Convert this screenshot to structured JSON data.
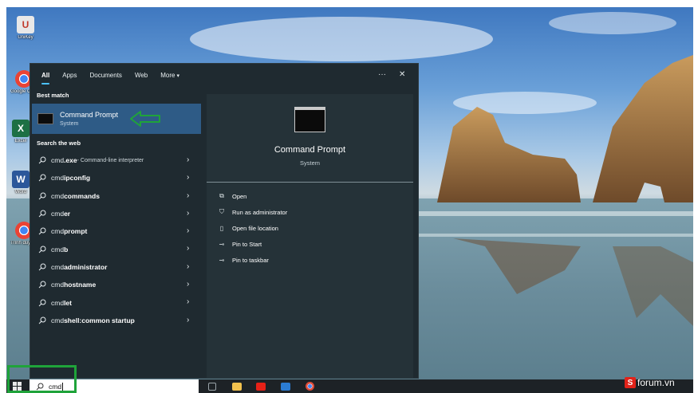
{
  "desktop_icons": [
    {
      "label": "UniKey",
      "icon": "unikey-icon",
      "color": "#d9d9d9",
      "glyph": "U"
    },
    {
      "label": "Google Chrome",
      "icon": "chrome-icon",
      "color": "#e94235",
      "glyph": ""
    },
    {
      "label": "Excel",
      "icon": "excel-icon",
      "color": "#1d7044",
      "glyph": "X"
    },
    {
      "label": "Word",
      "icon": "word-icon",
      "color": "#2b579a",
      "glyph": "W"
    },
    {
      "label": "Trình duyệt Chrome",
      "icon": "chrome-icon",
      "color": "#e94235",
      "glyph": ""
    }
  ],
  "tabs": [
    {
      "label": "All",
      "active": true
    },
    {
      "label": "Apps",
      "active": false
    },
    {
      "label": "Documents",
      "active": false
    },
    {
      "label": "Web",
      "active": false
    },
    {
      "label": "More",
      "active": false,
      "caret": "▾"
    }
  ],
  "panel_controls": {
    "more": "···",
    "close": "✕"
  },
  "best_match": {
    "heading": "Best match",
    "title": "Command Prompt",
    "subtitle": "System"
  },
  "web": {
    "heading": "Search the web",
    "results": [
      {
        "plain": "cmd",
        "bold": ".exe",
        "desc": " - Command-line interpreter"
      },
      {
        "plain": "cmd ",
        "bold": "ipconfig",
        "desc": ""
      },
      {
        "plain": "cmd ",
        "bold": "commands",
        "desc": ""
      },
      {
        "plain": "cmd",
        "bold": "er",
        "desc": ""
      },
      {
        "plain": "cmd ",
        "bold": "prompt",
        "desc": ""
      },
      {
        "plain": "cmd",
        "bold": "b",
        "desc": ""
      },
      {
        "plain": "cmd ",
        "bold": "administrator",
        "desc": ""
      },
      {
        "plain": "cmd ",
        "bold": "hostname",
        "desc": ""
      },
      {
        "plain": "cmd",
        "bold": "let",
        "desc": ""
      },
      {
        "plain": "cmd ",
        "bold": "shell:common startup",
        "desc": ""
      }
    ],
    "chevron": "›"
  },
  "detail": {
    "title": "Command Prompt",
    "subtitle": "System",
    "actions": [
      {
        "label": "Open",
        "icon": "open-icon",
        "glyph": "⧉"
      },
      {
        "label": "Run as administrator",
        "icon": "shield-run-icon",
        "glyph": "⛉"
      },
      {
        "label": "Open file location",
        "icon": "file-location-icon",
        "glyph": "▯"
      },
      {
        "label": "Pin to Start",
        "icon": "pin-start-icon",
        "glyph": "⊸"
      },
      {
        "label": "Pin to taskbar",
        "icon": "pin-taskbar-icon",
        "glyph": "⊸"
      }
    ]
  },
  "taskbar": {
    "search_value": "cmd",
    "apps": [
      {
        "icon": "task-view-icon",
        "color": "#9aa4a9"
      },
      {
        "icon": "file-explorer-icon",
        "color": "#f2c14e"
      },
      {
        "icon": "youtube-icon",
        "color": "#e62117"
      },
      {
        "icon": "word-icon",
        "color": "#2b7cd3"
      },
      {
        "icon": "chrome-icon",
        "color": "#dd4b39"
      }
    ]
  },
  "watermark": {
    "s": "S",
    "text": "forum.vn"
  },
  "colors": {
    "accent": "#4cc2ff",
    "selected_row": "#2e5b86",
    "annotation_green": "#1fa33a"
  }
}
